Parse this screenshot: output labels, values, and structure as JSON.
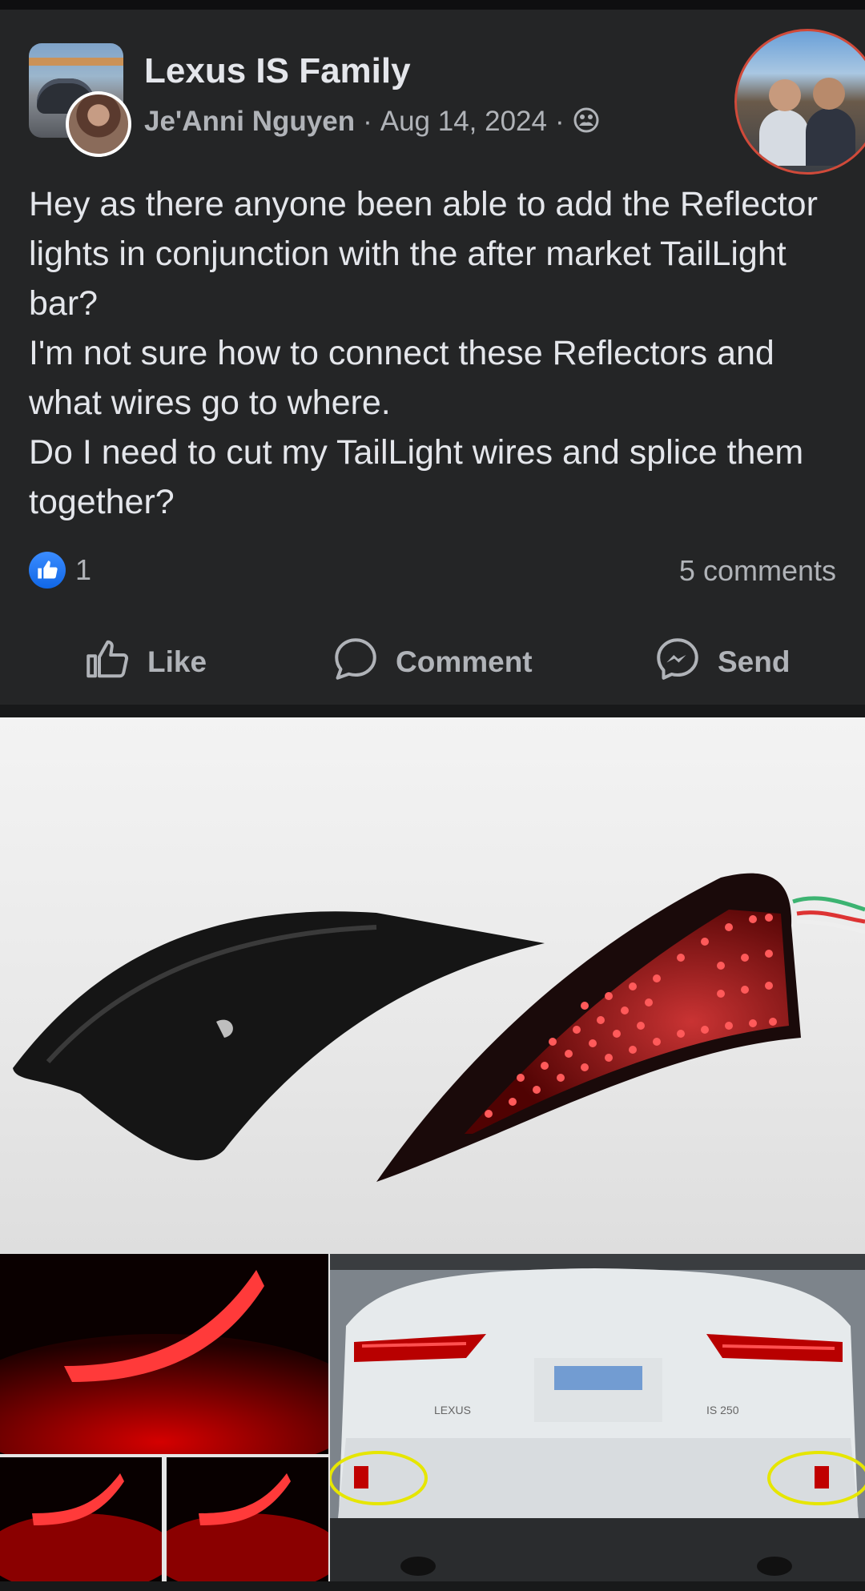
{
  "post": {
    "group_name": "Lexus IS Family",
    "author": "Je'Anni Nguyen",
    "separator": "·",
    "date": "Aug 14, 2024",
    "privacy_icon": "group-privacy-icon",
    "text_lines": [
      "Hey as there anyone been able to add the Reflector lights in conjunction with the after market TailLight bar?",
      "I'm not sure how to connect these Reflectors and what wires go to where.",
      "Do I need to cut my TailLight wires and splice them together?"
    ],
    "reaction_count": "1",
    "comments_count": "5 comments"
  },
  "actions": {
    "like_label": "Like",
    "comment_label": "Comment",
    "send_label": "Send"
  },
  "photos": {
    "car_badge_left": "LEXUS",
    "car_badge_right": "IS 250"
  },
  "colors": {
    "card_bg": "#242526",
    "text_primary": "#e4e6eb",
    "text_secondary": "#b0b3b8",
    "like_blue": "#1877f2",
    "led_red": "#ff2a2a",
    "highlight_yellow": "#e6e600"
  }
}
